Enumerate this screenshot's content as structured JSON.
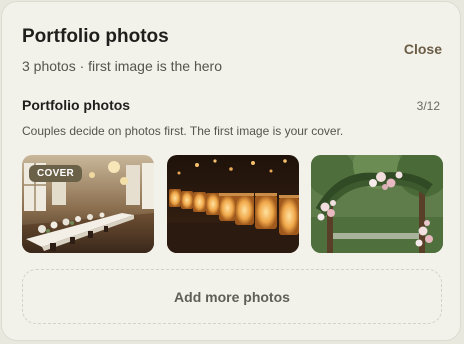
{
  "panel": {
    "title": "Portfolio photos",
    "subtitle": "3 photos · first image is the hero",
    "close_label": "Close"
  },
  "section": {
    "title": "Portfolio photos",
    "count": "3/12",
    "helper": "Couples decide on photos first. The first image is your cover."
  },
  "photos": [
    {
      "badge": "COVER",
      "subject": "banquet-hall-table"
    },
    {
      "subject": "candle-jars"
    },
    {
      "subject": "floral-arch"
    }
  ],
  "add_more_label": "Add more photos",
  "colors": {
    "card_bg": "#f2f1ea",
    "accent": "#6b5d46",
    "badge_bg": "#6b6148"
  }
}
